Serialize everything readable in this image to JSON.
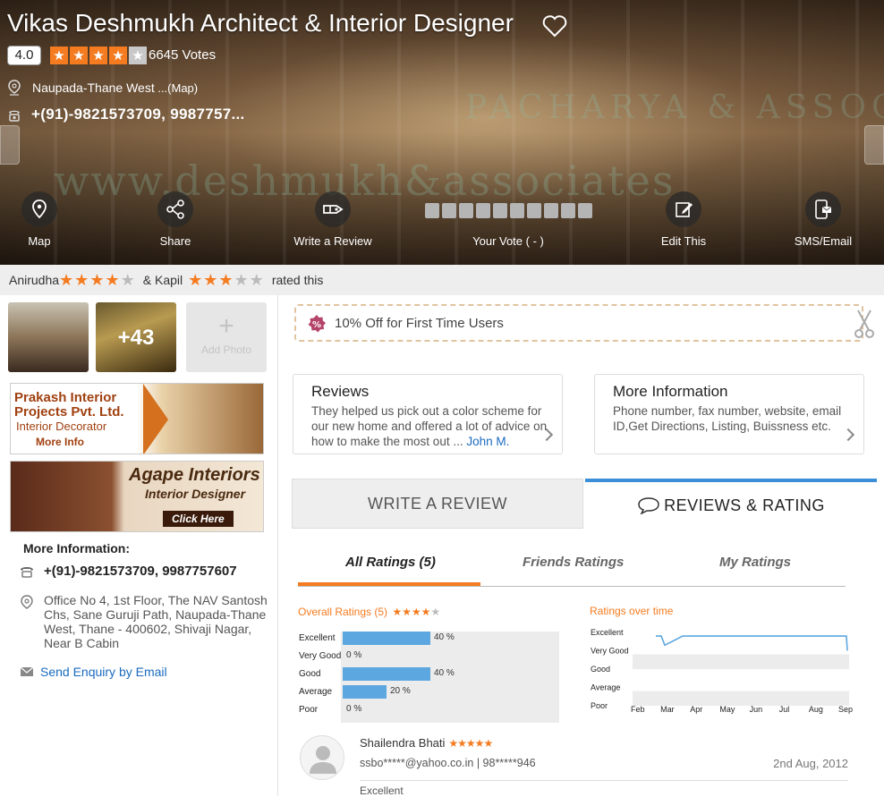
{
  "listing": {
    "title": "Vikas Deshmukh Architect & Interior Designer",
    "rating": "4.0",
    "stars": 4,
    "votes": "6645 Votes",
    "location": "Naupada-Thane West",
    "location_more": " ...(Map)",
    "phone": "+(91)-9821573709, 9987757...",
    "watermark1": "www.deshmukh&associates",
    "watermark2": "PACHARYA & ASSOCIATES"
  },
  "actions": [
    {
      "label": "Map",
      "icon": "map-pin-icon"
    },
    {
      "label": "Share",
      "icon": "share-icon"
    },
    {
      "label": "Write a Review",
      "icon": "pen-review-icon"
    },
    {
      "label": "Your Vote ( - )",
      "icon": "vote-squares"
    },
    {
      "label": "Edit This",
      "icon": "edit-icon"
    },
    {
      "label": "SMS/Email",
      "icon": "sms-email-icon"
    }
  ],
  "rated_by": {
    "user1": "Anirudha",
    "user1_stars": 3.5,
    "joiner": "& Kapil",
    "user2_stars": 2.5,
    "suffix": "rated this"
  },
  "photos": {
    "more_count": "+43",
    "add_label": "Add Photo"
  },
  "ads": {
    "ad1": {
      "name": "Prakash Interior",
      "name2": "Projects Pvt. Ltd.",
      "role": "Interior Decorator",
      "cta": "More Info"
    },
    "ad2": {
      "name": "Agape Interiors",
      "role": "Interior Designer",
      "cta": "Click Here"
    }
  },
  "more_info": {
    "title": "More Information:",
    "phone": "+(91)-9821573709, 9987757607",
    "address": "Office No 4, 1st Floor, The NAV Santosh Chs, Sane Guruji Path, Naupada-Thane West, Thane - 400602, Shivaji Nagar, Near B Cabin",
    "enquiry": "Send Enquiry by Email"
  },
  "offer": {
    "text": "10% Off for First Time Users"
  },
  "cards": {
    "reviews": {
      "title": "Reviews",
      "text": "They helped us pick out a color scheme for our new home and offered a lot of advice on how to make the most out",
      "ellipsis": " ... ",
      "author": "John M."
    },
    "more": {
      "title": "More Information",
      "text": "Phone number, fax number, website, email ID,Get Directions, Listing, Buissness etc."
    }
  },
  "tabs": {
    "write": "WRITE A REVIEW",
    "reviews": "REVIEWS & RATING"
  },
  "subtabs": {
    "all": "All Ratings (5)",
    "friends": "Friends Ratings",
    "mine": "My Ratings"
  },
  "overall": {
    "title": "Overall Ratings (5)",
    "stars": "★★★★",
    "star_off": "★",
    "rows": [
      {
        "label": "Excellent",
        "value": 40,
        "pct": "40 %"
      },
      {
        "label": "Very Good",
        "value": 0,
        "pct": "0 %"
      },
      {
        "label": "Good",
        "value": 40,
        "pct": "40 %"
      },
      {
        "label": "Average",
        "value": 20,
        "pct": "20 %"
      },
      {
        "label": "Poor",
        "value": 0,
        "pct": "0 %"
      }
    ]
  },
  "over_time": {
    "title": "Ratings over time",
    "y_labels": [
      "Excellent",
      "Very Good",
      "Good",
      "Average",
      "Poor"
    ],
    "x_labels": [
      "Feb",
      "Mar",
      "Apr",
      "May",
      "Jun",
      "Jul",
      "Aug",
      "Sep"
    ]
  },
  "chart_data": {
    "type": "line",
    "title": "Ratings over time",
    "categories": [
      "Excellent",
      "Very Good",
      "Good",
      "Average",
      "Poor"
    ],
    "x": [
      "Feb",
      "Mar",
      "Apr",
      "May",
      "Jun",
      "Jul",
      "Aug",
      "Sep"
    ],
    "series": [
      {
        "values": [
          4.9,
          4.4,
          4.9,
          4.9,
          4.9,
          4.9,
          4.9,
          4.1
        ]
      }
    ]
  },
  "review": {
    "name": "Shailendra Bhati",
    "stars": "★★★★★",
    "email": "ssbo*****@yahoo.co.in | 98*****946",
    "date": "2nd Aug, 2012",
    "rating_word": "Excellent"
  },
  "colors": {
    "accent": "#f47b20",
    "blue": "#3a8fd8",
    "link": "#1a6bbf",
    "bar": "#5da7e0"
  }
}
